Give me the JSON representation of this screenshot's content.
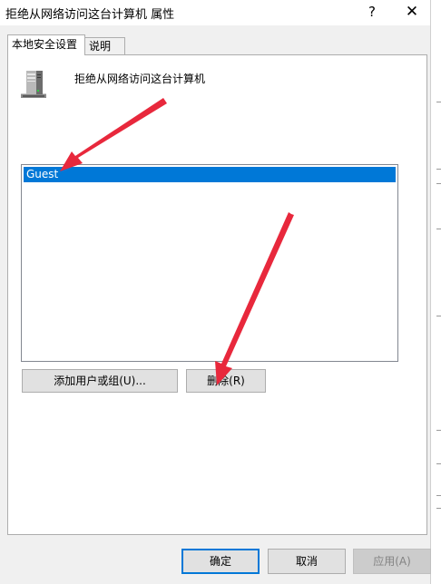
{
  "window": {
    "title": "拒绝从网络访问这台计算机 属性",
    "help_label": "?",
    "close_label": "✕"
  },
  "tabs": [
    {
      "label": "本地安全设置",
      "active": true
    },
    {
      "label": "说明",
      "active": false
    }
  ],
  "policy": {
    "name": "拒绝从网络访问这台计算机",
    "icon": "server-icon"
  },
  "list": {
    "items": [
      {
        "label": "Guest",
        "selected": true
      }
    ]
  },
  "buttons": {
    "add_label": "添加用户或组(U)...",
    "remove_label": "删除(R)",
    "ok_label": "确定",
    "cancel_label": "取消",
    "apply_label": "应用(A)"
  },
  "annotations": {
    "arrow_color": "#e8283c",
    "count": 2
  },
  "colors": {
    "selection": "#0078d7",
    "dialog_bg": "#f0f0f0",
    "button_bg": "#e1e1e1",
    "button_border": "#adadad"
  }
}
